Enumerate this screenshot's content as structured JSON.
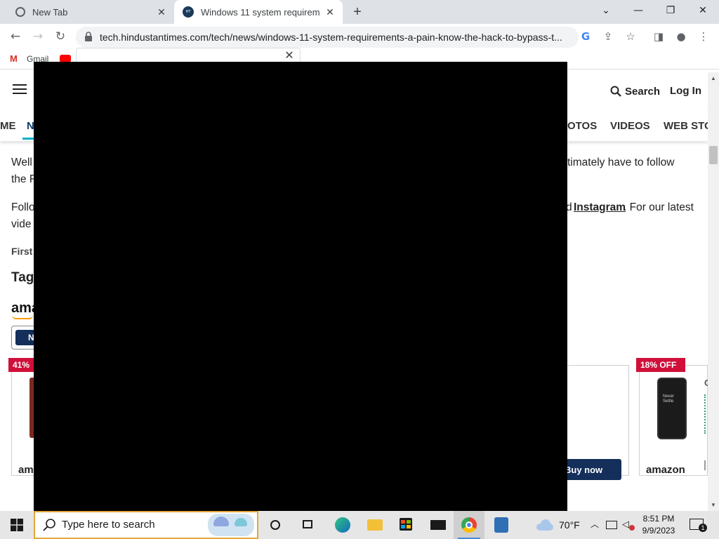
{
  "browser": {
    "tabs": [
      {
        "title": "New Tab",
        "favicon": "chrome-icon"
      },
      {
        "title": "Windows 11 system requirement",
        "favicon": "ht-tech-icon",
        "active": true
      }
    ],
    "url": "tech.hindustantimes.com/tech/news/windows-11-system-requirements-a-pain-know-the-hack-to-bypass-t...",
    "bookmarks": [
      {
        "label": "Gmail",
        "icon": "gmail-icon"
      },
      {
        "label": "",
        "icon": "youtube-icon"
      }
    ]
  },
  "site": {
    "header": {
      "search_label": "Search",
      "login_label": "Log In"
    },
    "nav": [
      "ME",
      "N",
      "OTOS",
      "VIDEOS",
      "WEB STO"
    ]
  },
  "article": {
    "p1_left": "Well",
    "p1_right": "timately have to follow",
    "p1_line2": "the F",
    "p2_left": "Follo",
    "p2_mid": "d",
    "p2_link": "Instagram",
    "p2_right": ". For our latest",
    "p2_line2": "vide",
    "first": "First",
    "tags": "Tags",
    "amazon_logo": "ama"
  },
  "products": {
    "button_fragment": "N",
    "badge_left": "41%",
    "badge_right": "18% OFF",
    "phone_screen_text": "Never Settle",
    "store_left": "am",
    "buy_now": "Buy now",
    "store_right": "amazon",
    "product_right_fragment": "C"
  },
  "taskbar": {
    "search_placeholder": "Type here to search",
    "weather": "70°F",
    "time": "8:51 PM",
    "date": "9/9/2023",
    "notification_count": "1"
  },
  "colors": {
    "accent_nav": "#00b1cd",
    "badge_red": "#d0103a",
    "amazon_navy": "#132f5a",
    "search_border": "#e5a83a"
  }
}
